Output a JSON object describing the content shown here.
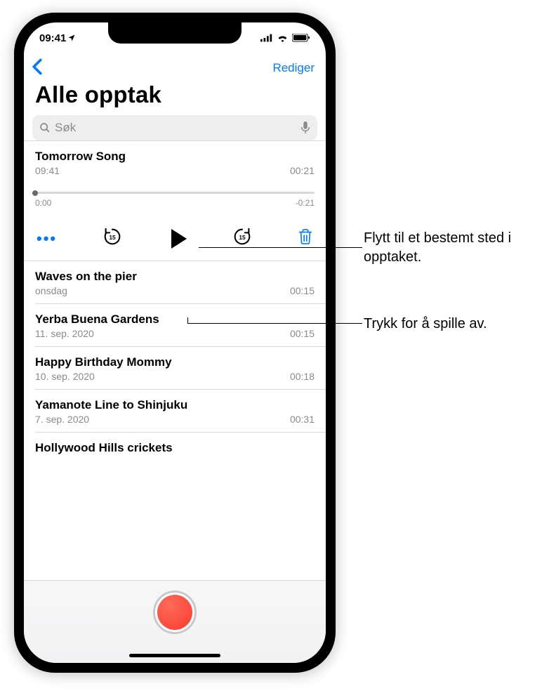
{
  "status_bar": {
    "time": "09:41"
  },
  "nav": {
    "edit": "Rediger"
  },
  "title": "Alle opptak",
  "search": {
    "placeholder": "Søk"
  },
  "expanded": {
    "title": "Tomorrow Song",
    "time_recorded": "09:41",
    "duration": "00:21",
    "elapsed": "0:00",
    "remaining": "-0:21"
  },
  "recordings": [
    {
      "title": "Waves on the pier",
      "date": "onsdag",
      "duration": "00:15"
    },
    {
      "title": "Yerba Buena Gardens",
      "date": "11. sep. 2020",
      "duration": "00:15"
    },
    {
      "title": "Happy Birthday Mommy",
      "date": "10. sep. 2020",
      "duration": "00:18"
    },
    {
      "title": "Yamanote Line to Shinjuku",
      "date": "7. sep. 2020",
      "duration": "00:31"
    },
    {
      "title": "Hollywood Hills crickets",
      "date": "",
      "duration": ""
    }
  ],
  "callouts": {
    "scrub": "Flytt til et bestemt sted i opptaket.",
    "play": "Trykk for å spille av."
  }
}
